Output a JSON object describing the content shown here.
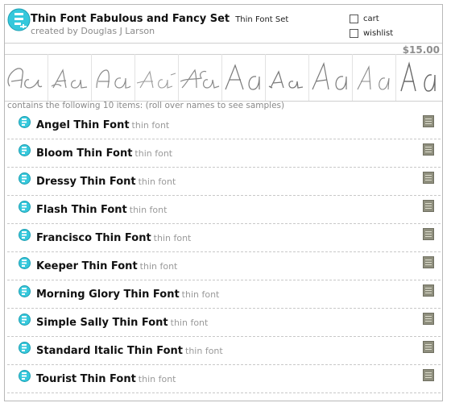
{
  "product": {
    "title": "Thin Font Fabulous and Fancy Set",
    "subtitle": "Thin Font Set",
    "creator": "created by Douglas J Larson",
    "price": "$15.00",
    "logo_icon": "font-set-logo-icon",
    "accent_color": "#35c8dc"
  },
  "actions": {
    "cart_label": "cart",
    "wishlist_label": "wishlist",
    "cart_checked": false,
    "wishlist_checked": false
  },
  "samples": [
    {
      "name": "Angel Thin Font",
      "glyph": "Aa"
    },
    {
      "name": "Bloom Thin Font",
      "glyph": "Aa"
    },
    {
      "name": "Dressy Thin Font",
      "glyph": "Aa"
    },
    {
      "name": "Flash Thin Font",
      "glyph": "Aa"
    },
    {
      "name": "Francisco Thin Font",
      "glyph": "Aa"
    },
    {
      "name": "Keeper Thin Font",
      "glyph": "Aa"
    },
    {
      "name": "Morning Glory Thin Font",
      "glyph": "Aa"
    },
    {
      "name": "Simple Sally Thin Font",
      "glyph": "Aa"
    },
    {
      "name": "Standard Italic Thin Font",
      "glyph": "Aa"
    },
    {
      "name": "Tourist Thin Font",
      "glyph": "Aa"
    }
  ],
  "contains_text": "contains the following 10 items: (roll over names to see samples)",
  "items": [
    {
      "name": "Angel Thin Font",
      "type": "thin font"
    },
    {
      "name": "Bloom Thin Font",
      "type": "thin font"
    },
    {
      "name": "Dressy Thin Font",
      "type": "thin font"
    },
    {
      "name": "Flash Thin Font",
      "type": "thin font"
    },
    {
      "name": "Francisco Thin Font",
      "type": "thin font"
    },
    {
      "name": "Keeper Thin Font",
      "type": "thin font"
    },
    {
      "name": "Morning Glory Thin Font",
      "type": "thin font"
    },
    {
      "name": "Simple Sally Thin Font",
      "type": "thin font"
    },
    {
      "name": "Standard Italic Thin Font",
      "type": "thin font"
    },
    {
      "name": "Tourist Thin Font",
      "type": "thin font"
    }
  ]
}
